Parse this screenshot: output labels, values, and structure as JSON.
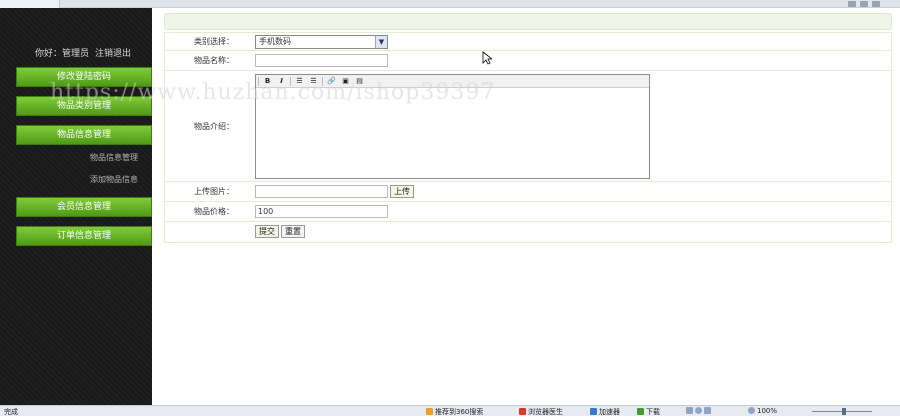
{
  "sidebar": {
    "greeting": "你好：管理员",
    "logout": "注销退出",
    "menu": [
      {
        "label": "修改登陆密码"
      },
      {
        "label": "物品类别管理"
      },
      {
        "label": "物品信息管理"
      },
      {
        "label": "会员信息管理"
      },
      {
        "label": "订单信息管理"
      }
    ],
    "submenu": [
      {
        "label": "物品信息管理"
      },
      {
        "label": "添加物品信息"
      }
    ]
  },
  "form": {
    "category_label": "类别选择：",
    "category_value": "手机数码",
    "name_label": "物品名称：",
    "name_value": "",
    "intro_label": "物品介绍：",
    "upload_label": "上传图片：",
    "upload_button": "上传",
    "price_label": "物品价格：",
    "price_value": "100",
    "submit_button": "提交",
    "reset_button": "重置"
  },
  "editor_toolbar": [
    {
      "icon": "bold-icon",
      "glyph": "B"
    },
    {
      "icon": "italic-icon",
      "glyph": "I"
    },
    {
      "icon": "ordered-list-icon",
      "glyph": "☰"
    },
    {
      "icon": "unordered-list-icon",
      "glyph": "☰"
    },
    {
      "icon": "link-icon",
      "glyph": "🔗"
    },
    {
      "icon": "image-icon",
      "glyph": "▣"
    },
    {
      "icon": "source-icon",
      "glyph": "▤"
    }
  ],
  "watermark": "https://www.huzhan.com/ishop39397",
  "statusbar": {
    "status": "完成",
    "items": [
      {
        "label": "推荐到360搜索"
      },
      {
        "label": "浏览器医生"
      },
      {
        "label": "加速器"
      },
      {
        "label": "下载"
      }
    ],
    "zoom": "100%"
  },
  "colors": {
    "sidebar_bg": "#1c1c1c",
    "menu_green": "#5fae1f",
    "form_border": "#e3ecd8"
  }
}
